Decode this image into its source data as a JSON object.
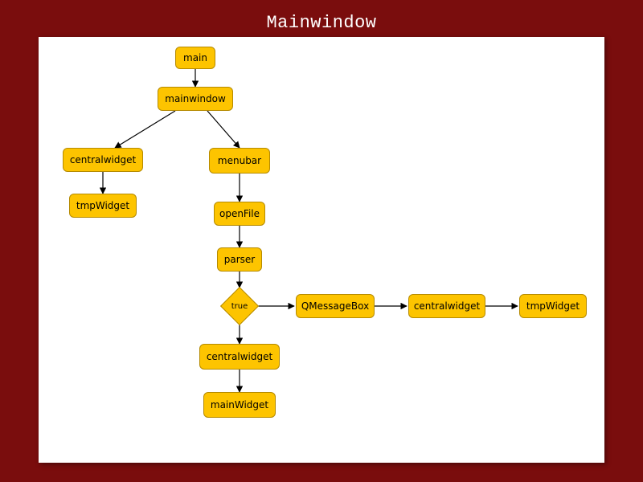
{
  "title": "Mainwindow",
  "nodes": {
    "main": "main",
    "mainwindow": "mainwindow",
    "centralwidgetL": "centralwidget",
    "tmpWidgetL": "tmpWidget",
    "menubar": "menubar",
    "openFile": "openFile",
    "parser": "parser",
    "true": "true",
    "centralwidgetB": "centralwidget",
    "mainWidget": "mainWidget",
    "QMessageBox": "QMessageBox",
    "centralwidgetR": "centralwidget",
    "tmpWidgetR": "tmpWidget"
  },
  "chart_data": {
    "type": "flowchart",
    "title": "Mainwindow",
    "nodes": [
      {
        "id": "main",
        "label": "main",
        "shape": "box"
      },
      {
        "id": "mainwindow",
        "label": "mainwindow",
        "shape": "box"
      },
      {
        "id": "centralwidgetL",
        "label": "centralwidget",
        "shape": "box"
      },
      {
        "id": "tmpWidgetL",
        "label": "tmpWidget",
        "shape": "box"
      },
      {
        "id": "menubar",
        "label": "menubar",
        "shape": "box"
      },
      {
        "id": "openFile",
        "label": "openFile",
        "shape": "box"
      },
      {
        "id": "parser",
        "label": "parser",
        "shape": "box"
      },
      {
        "id": "true",
        "label": "true",
        "shape": "diamond"
      },
      {
        "id": "centralwidgetB",
        "label": "centralwidget",
        "shape": "box"
      },
      {
        "id": "mainWidget",
        "label": "mainWidget",
        "shape": "box"
      },
      {
        "id": "QMessageBox",
        "label": "QMessageBox",
        "shape": "box"
      },
      {
        "id": "centralwidgetR",
        "label": "centralwidget",
        "shape": "box"
      },
      {
        "id": "tmpWidgetR",
        "label": "tmpWidget",
        "shape": "box"
      }
    ],
    "edges": [
      {
        "from": "main",
        "to": "mainwindow"
      },
      {
        "from": "mainwindow",
        "to": "centralwidgetL"
      },
      {
        "from": "mainwindow",
        "to": "menubar"
      },
      {
        "from": "centralwidgetL",
        "to": "tmpWidgetL"
      },
      {
        "from": "menubar",
        "to": "openFile"
      },
      {
        "from": "openFile",
        "to": "parser"
      },
      {
        "from": "parser",
        "to": "true"
      },
      {
        "from": "true",
        "to": "centralwidgetB"
      },
      {
        "from": "centralwidgetB",
        "to": "mainWidget"
      },
      {
        "from": "true",
        "to": "QMessageBox"
      },
      {
        "from": "QMessageBox",
        "to": "centralwidgetR"
      },
      {
        "from": "centralwidgetR",
        "to": "tmpWidgetR"
      }
    ]
  }
}
